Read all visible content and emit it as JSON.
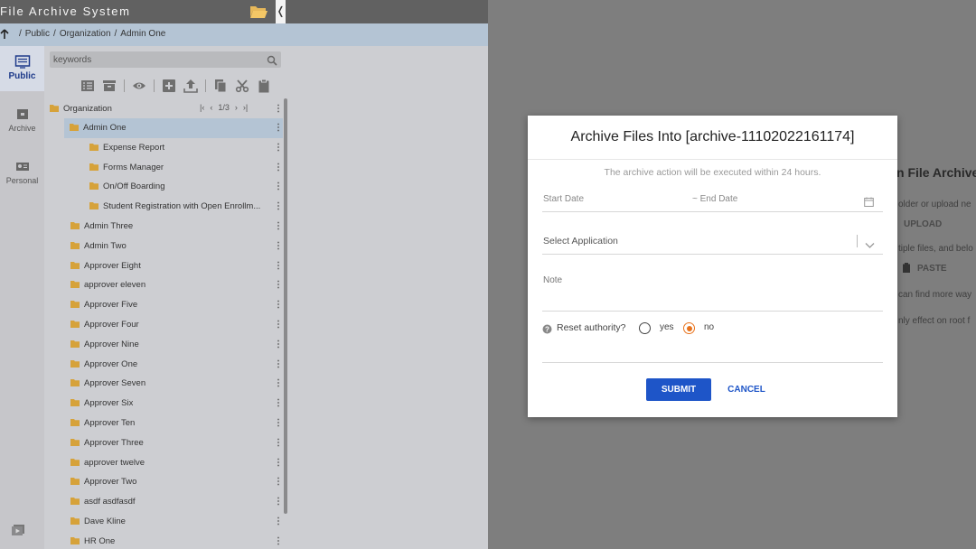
{
  "header": {
    "title": "File Archive System",
    "collapse_glyph": "❬"
  },
  "breadcrumb": {
    "items": [
      "Public",
      "Organization",
      "Admin One"
    ],
    "separator": "/"
  },
  "rail": {
    "items": [
      {
        "label": "Public",
        "icon": "list-board-icon",
        "active": true
      },
      {
        "label": "Archive",
        "icon": "archive-box-icon",
        "active": false
      },
      {
        "label": "Personal",
        "icon": "id-card-icon",
        "active": false
      }
    ],
    "bottom_icon": "play-video-icon"
  },
  "tree_panel": {
    "search_placeholder": "keywords",
    "toolbar_icons": [
      "list-icon",
      "archive-icon",
      "view-icon",
      "add-icon",
      "upload-icon",
      "copy-icon",
      "cut-icon",
      "paste-icon"
    ],
    "root": {
      "label": "Organization",
      "page": "1/3"
    },
    "items": [
      {
        "label": "Admin One",
        "level": 1,
        "selected": true
      },
      {
        "label": "Expense Report",
        "level": 2,
        "selected": false
      },
      {
        "label": "Forms Manager",
        "level": 2,
        "selected": false
      },
      {
        "label": "On/Off Boarding",
        "level": 2,
        "selected": false
      },
      {
        "label": "Student Registration with Open Enrollm...",
        "level": 2,
        "selected": false
      },
      {
        "label": "Admin Three",
        "level": 1,
        "selected": false
      },
      {
        "label": "Admin Two",
        "level": 1,
        "selected": false
      },
      {
        "label": "Approver Eight",
        "level": 1,
        "selected": false
      },
      {
        "label": "approver eleven",
        "level": 1,
        "selected": false
      },
      {
        "label": "Approver Five",
        "level": 1,
        "selected": false
      },
      {
        "label": "Approver Four",
        "level": 1,
        "selected": false
      },
      {
        "label": "Approver Nine",
        "level": 1,
        "selected": false
      },
      {
        "label": "Approver One",
        "level": 1,
        "selected": false
      },
      {
        "label": "Approver Seven",
        "level": 1,
        "selected": false
      },
      {
        "label": "Approver Six",
        "level": 1,
        "selected": false
      },
      {
        "label": "Approver Ten",
        "level": 1,
        "selected": false
      },
      {
        "label": "Approver Three",
        "level": 1,
        "selected": false
      },
      {
        "label": "approver twelve",
        "level": 1,
        "selected": false
      },
      {
        "label": "Approver Two",
        "level": 1,
        "selected": false
      },
      {
        "label": "asdf asdfasdf",
        "level": 1,
        "selected": false
      },
      {
        "label": "Dave Kline",
        "level": 1,
        "selected": false
      },
      {
        "label": "HR One",
        "level": 1,
        "selected": false
      }
    ]
  },
  "background": {
    "heading": "n File Archive",
    "line1": "older or upload ne",
    "upload_label": "UPLOAD",
    "line2": "tiple files, and belo",
    "paste_label": "PASTE",
    "line3": "can find more way",
    "line4": "nly effect on root f"
  },
  "dialog": {
    "title": "Archive Files Into [archive-11102022161174]",
    "info": "The archive action will be executed within 24 hours.",
    "start_date_placeholder": "Start Date",
    "end_date_placeholder": "~ End Date",
    "application_placeholder": "Select Application",
    "note_placeholder": "Note",
    "reset_label": "Reset authority?",
    "option_yes": "yes",
    "option_no": "no",
    "selected_option": "no",
    "submit_label": "SUBMIT",
    "cancel_label": "CANCEL"
  },
  "colors": {
    "accent_blue": "#1e55c8",
    "radio_orange": "#e8731d",
    "header_gray": "#616161",
    "selection_blue": "#b4c4d4",
    "folder_gold": "#d6a23a"
  }
}
